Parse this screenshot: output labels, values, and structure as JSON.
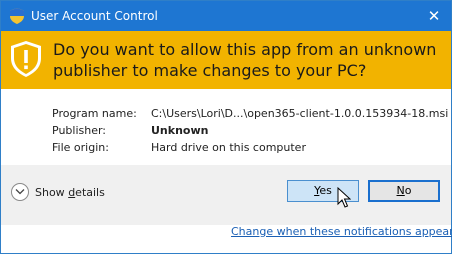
{
  "window": {
    "title": "User Account Control",
    "close_glyph": "✕",
    "title_icon": "uac-shield-icon"
  },
  "banner": {
    "icon": "warning-shield-icon",
    "question": "Do you want to allow this app from an unknown publisher to make changes to your PC?"
  },
  "details": {
    "rows": [
      {
        "label": "Program name:",
        "value": "C:\\Users\\Lori\\D...\\open365-client-1.0.0.153934-18.msi"
      },
      {
        "label": "Publisher:",
        "value": "Unknown"
      },
      {
        "label": "File origin:",
        "value": "Hard drive on this computer"
      }
    ]
  },
  "actions": {
    "show_details_prefix": "Show ",
    "show_details_accel": "d",
    "show_details_suffix": "etails",
    "yes_accel": "Y",
    "yes_rest": "es",
    "no_accel": "N",
    "no_rest": "o"
  },
  "footer": {
    "link": "Change when these notifications appear"
  },
  "colors": {
    "titlebar": "#1e76d2",
    "banner": "#f2b300",
    "link": "#1a5fb4"
  }
}
